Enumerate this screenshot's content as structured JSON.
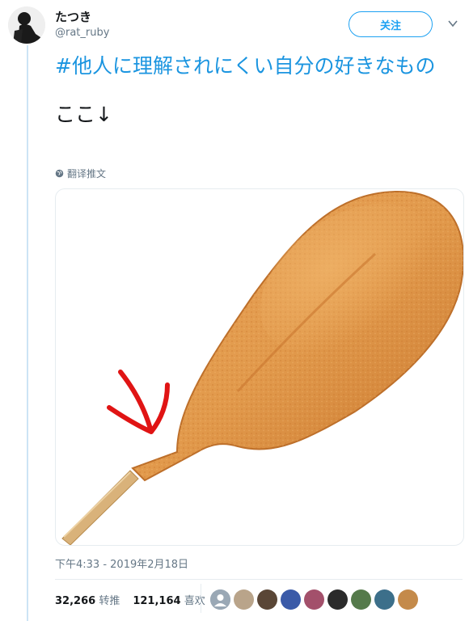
{
  "author": {
    "display_name": "たつき",
    "screen_name": "@rat_ruby"
  },
  "follow_label": "关注",
  "tweet": {
    "hashtag": "#他人に理解されにくい自分の好きなもの",
    "text_line2": "ここ↓",
    "translate_label": "翻译推文"
  },
  "timestamp": "下午4:33 - 2019年2月18日",
  "stats": {
    "retweets_count": "32,266",
    "retweets_label": "转推",
    "likes_count": "121,164",
    "likes_label": "喜欢"
  },
  "likers": [
    {
      "icon": "default-avatar",
      "color": "#9aa8b5"
    },
    {
      "icon": "avatar",
      "color": "#b9a48a"
    },
    {
      "icon": "avatar",
      "color": "#5a4636"
    },
    {
      "icon": "avatar",
      "color": "#3a5aa8"
    },
    {
      "icon": "avatar",
      "color": "#a3506b"
    },
    {
      "icon": "avatar",
      "color": "#2b2b2b"
    },
    {
      "icon": "avatar",
      "color": "#557a4b"
    },
    {
      "icon": "avatar",
      "color": "#3c6f8a"
    },
    {
      "icon": "avatar",
      "color": "#c48a4a"
    }
  ],
  "colors": {
    "accent": "#1da1f2",
    "hashtag": "#1b95e0",
    "thread": "#cce4f5"
  }
}
